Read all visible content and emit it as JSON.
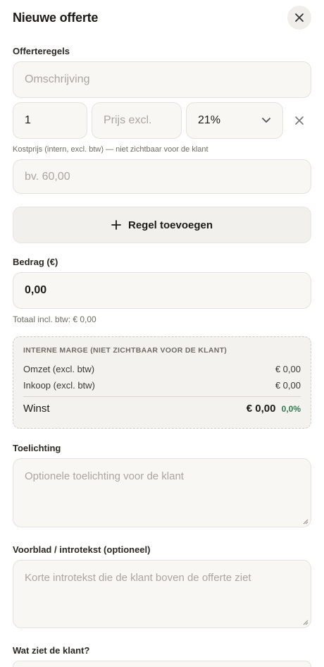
{
  "header": {
    "title": "Nieuwe offerte"
  },
  "lines": {
    "label": "Offerteregels",
    "description_placeholder": "Omschrijving",
    "quantity": "1",
    "price_placeholder": "Prijs excl.",
    "vat": "21%",
    "cost_label": "Kostprijs (intern, excl. btw) — niet zichtbaar voor de klant",
    "cost_placeholder": "bv. 60,00",
    "add_label": "Regel toevoegen"
  },
  "amount": {
    "label": "Bedrag (€)",
    "value": "0,00",
    "total": "Totaal incl. btw: € 0,00"
  },
  "margin": {
    "header": "INTERNE MARGE (NIET ZICHTBAAR VOOR DE KLANT)",
    "revenue_label": "Omzet (excl. btw)",
    "revenue_value": "€ 0,00",
    "purchase_label": "Inkoop (excl. btw)",
    "purchase_value": "€ 0,00",
    "profit_label": "Winst",
    "profit_value": "€ 0,00",
    "profit_pct": "0,0%"
  },
  "notes": {
    "label": "Toelichting",
    "placeholder": "Optionele toelichting voor de klant"
  },
  "intro": {
    "label": "Voorblad / introtekst (optioneel)",
    "placeholder": "Korte introtekst die de klant boven de offerte ziet"
  },
  "visibility": {
    "label": "Wat ziet de klant?"
  },
  "colors": {
    "accent_green": "#2f7a4d",
    "field_bg": "#f8f7f4"
  }
}
